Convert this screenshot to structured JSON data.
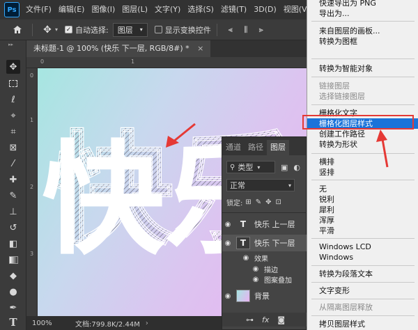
{
  "menubar": {
    "logo": "Ps",
    "items": [
      "文件(F)",
      "编辑(E)",
      "图像(I)",
      "图层(L)",
      "文字(Y)",
      "选择(S)",
      "滤镜(T)",
      "3D(D)",
      "视图(V)"
    ]
  },
  "options": {
    "auto_select_label": "自动选择:",
    "auto_select_value": "图层",
    "show_transform_label": "显示变换控件"
  },
  "document": {
    "tab_title": "未标题-1 @ 100% (快乐 下一层, RGB/8#) *",
    "canvas_text": "快乐",
    "zoom": "100%",
    "doc_info": "文档:799.8K/2.44M"
  },
  "rulers": {
    "top": [
      "0",
      "1"
    ],
    "left": [
      "0",
      "1",
      "2",
      "3"
    ]
  },
  "layers_panel": {
    "tabs": [
      "通道",
      "路径",
      "图层"
    ],
    "filter_label": "类型",
    "blend_mode": "正常",
    "lock_label": "锁定:",
    "layers": [
      {
        "name": "快乐 上一层",
        "thumb": "T"
      },
      {
        "name": "快乐 下一层",
        "thumb": "T"
      },
      {
        "name": "效果",
        "thumb": ""
      },
      {
        "name": "描边",
        "thumb": ""
      },
      {
        "name": "图案叠加",
        "thumb": ""
      },
      {
        "name": "背景",
        "thumb": ""
      }
    ]
  },
  "context_menu": {
    "items": [
      {
        "label": "快速导出为 PNG"
      },
      {
        "label": "导出为..."
      },
      {
        "label": "来自图层的画板..."
      },
      {
        "label": "转换为图框"
      },
      {
        "label": "转换为智能对象"
      },
      {
        "label": "链接图层"
      },
      {
        "label": "选择链接图层"
      },
      {
        "label": "栅格化文字"
      },
      {
        "label": "栅格化图层样式"
      },
      {
        "label": "创建工作路径"
      },
      {
        "label": "转换为形状"
      },
      {
        "label": "横排"
      },
      {
        "label": "竖排"
      },
      {
        "label": "无"
      },
      {
        "label": "锐利"
      },
      {
        "label": "犀利"
      },
      {
        "label": "浑厚"
      },
      {
        "label": "平滑"
      },
      {
        "label": "Windows LCD"
      },
      {
        "label": "Windows"
      },
      {
        "label": "转换为段落文本"
      },
      {
        "label": "文字变形"
      },
      {
        "label": "从隔离图层释放"
      },
      {
        "label": "拷贝图层样式"
      }
    ]
  },
  "colors": {
    "highlight": "#1a73d9",
    "annotation": "#e53935"
  }
}
